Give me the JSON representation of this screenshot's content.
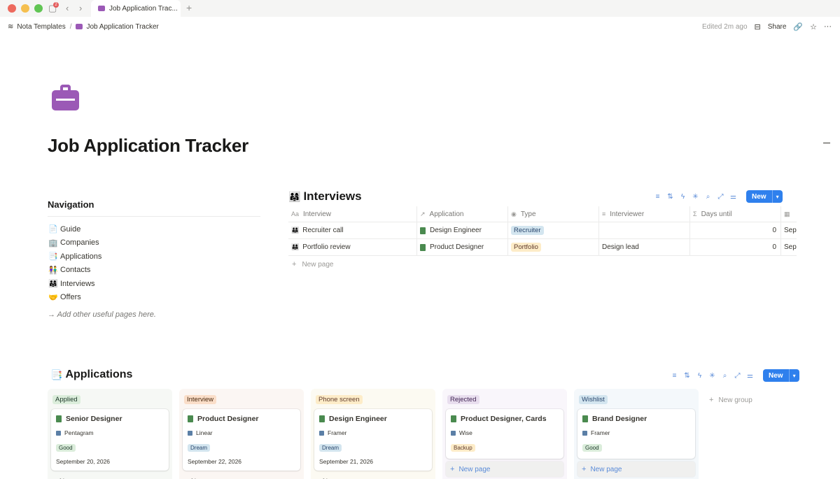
{
  "window": {
    "tab_title": "Job Application Trac...",
    "notification_count": "2"
  },
  "breadcrumb": {
    "workspace": "Nota Templates",
    "page": "Job Application Tracker"
  },
  "topbar": {
    "edited": "Edited 2m ago",
    "share_label": "Share"
  },
  "page": {
    "title": "Job Application Tracker",
    "icon": "briefcase-icon",
    "accent_color": "#9b59b6"
  },
  "navigation": {
    "heading": "Navigation",
    "items": [
      {
        "label": "Guide",
        "icon": "📄"
      },
      {
        "label": "Companies",
        "icon": "🏢"
      },
      {
        "label": "Applications",
        "icon": "📑"
      },
      {
        "label": "Contacts",
        "icon": "👫"
      },
      {
        "label": "Interviews",
        "icon": "👨‍👩‍👧"
      },
      {
        "label": "Offers",
        "icon": "🤝"
      }
    ],
    "hint": "→ Add other useful pages here."
  },
  "interviews": {
    "title": "Interviews",
    "new_label": "New",
    "columns": [
      "Interview",
      "Application",
      "Type",
      "Interviewer",
      "Days until"
    ],
    "rows": [
      {
        "interview": "Recruiter call",
        "application": "Design Engineer",
        "type": "Recruiter",
        "interviewer": "",
        "days_until": "0",
        "date": "Sep"
      },
      {
        "interview": "Portfolio review",
        "application": "Product Designer",
        "type": "Portfolio",
        "interviewer": "Design lead",
        "days_until": "0",
        "date": "Sep"
      }
    ],
    "new_page": "New page"
  },
  "applications": {
    "title": "Applications",
    "new_label": "New",
    "new_group": "New group",
    "new_page": "New page",
    "columns": [
      {
        "status": "Applied",
        "card": {
          "title": "Senior Designer",
          "company": "Pentagram",
          "tag": "Good",
          "date": "September 20, 2026"
        }
      },
      {
        "status": "Interview",
        "card": {
          "title": "Product Designer",
          "company": "Linear",
          "tag": "Dream",
          "date": "September 22, 2026"
        }
      },
      {
        "status": "Phone screen",
        "card": {
          "title": "Design Engineer",
          "company": "Framer",
          "tag": "Dream",
          "date": "September 21, 2026"
        }
      },
      {
        "status": "Rejected",
        "card": {
          "title": "Product Designer, Cards",
          "company": "Wise",
          "tag": "Backup",
          "date": ""
        }
      },
      {
        "status": "Wishlist",
        "card": {
          "title": "Brand Designer",
          "company": "Framer",
          "tag": "Good",
          "date": ""
        }
      }
    ]
  }
}
